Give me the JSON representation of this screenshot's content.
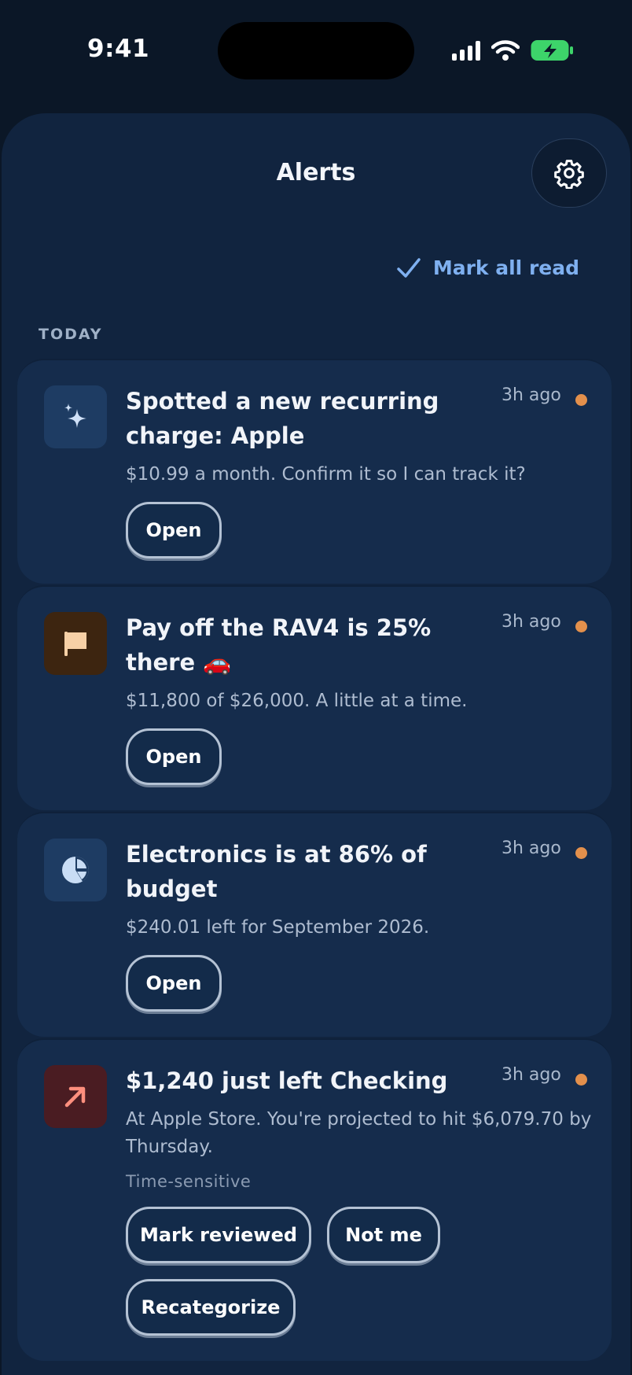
{
  "status_bar": {
    "time": "9:41",
    "icons": [
      "cellular-signal-icon",
      "wifi-icon",
      "battery-charging-icon"
    ]
  },
  "header": {
    "title": "Alerts",
    "settings_icon": "gear-icon"
  },
  "mark_all": {
    "label": "Mark all read",
    "icon": "checkmark-icon"
  },
  "section": {
    "label": "TODAY"
  },
  "colors": {
    "background": "#0b1727",
    "sheet": "#11243f",
    "card": "#152c4c",
    "accent": "#7fb0f0",
    "unread_dot": "#e3904c"
  },
  "alerts": [
    {
      "icon": "sparkles-icon",
      "title": "Spotted a new recurring charge: Apple",
      "time": "3h ago",
      "body": "$10.99 a month. Confirm it so I can track it?",
      "actions": [
        "Open"
      ]
    },
    {
      "icon": "flag-icon",
      "title": "Pay off the RAV4 is 25% there 🚗",
      "time": "3h ago",
      "body": "$11,800 of $26,000. A little at a time.",
      "actions": [
        "Open"
      ]
    },
    {
      "icon": "pie-chart-icon",
      "title": "Electronics is at 86% of budget",
      "time": "3h ago",
      "body": "$240.01 left for September 2026.",
      "actions": [
        "Open"
      ]
    },
    {
      "icon": "arrow-up-right-icon",
      "title": "$1,240 just left Checking",
      "time": "3h ago",
      "body": "At Apple Store. You're projected to hit $6,079.70 by Thursday.",
      "meta": "Time-sensitive",
      "actions": [
        "Mark reviewed",
        "Not me",
        "Recategorize"
      ]
    }
  ]
}
